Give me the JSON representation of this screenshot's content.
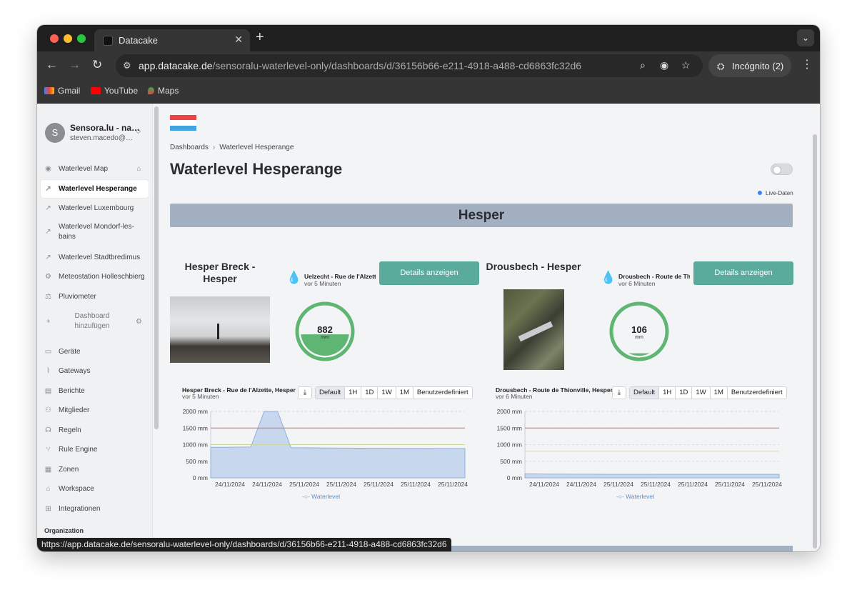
{
  "browser": {
    "tab_title": "Datacake",
    "url_host": "app.datacake.de",
    "url_path": "/sensoralu-waterlevel-only/dashboards/d/36156b66-e211-4918-a488-cd6863fc32d6",
    "incognito_label": "Incógnito (2)",
    "bookmarks": [
      "Gmail",
      "YouTube",
      "Maps"
    ],
    "status_url": "https://app.datacake.de/sensoralu-waterlevel-only/dashboards/d/36156b66-e211-4918-a488-cd6863fc32d6"
  },
  "sidebar": {
    "avatar_letter": "S",
    "org_name": "Sensora.lu - na…",
    "org_email": "steven.macedo@…",
    "dashboards": [
      {
        "label": "Waterlevel Map",
        "icon": "map-pin-icon"
      },
      {
        "label": "Waterlevel Hesperange",
        "icon": "line-chart-icon"
      },
      {
        "label": "Waterlevel Luxembourg",
        "icon": "line-chart-icon"
      },
      {
        "label": "Waterlevel Mondorf-les-bains",
        "icon": "line-chart-icon"
      },
      {
        "label": "Waterlevel Stadtbredimus",
        "icon": "line-chart-icon"
      },
      {
        "label": "Meteostation Holleschbierg",
        "icon": "gear-icon"
      },
      {
        "label": "Pluviometer",
        "icon": "scale-icon"
      },
      {
        "label": "Dashboard hinzufügen",
        "icon": "plus-icon"
      }
    ],
    "nav": [
      {
        "label": "Geräte",
        "icon": "device-icon"
      },
      {
        "label": "Gateways",
        "icon": "antenna-icon"
      },
      {
        "label": "Berichte",
        "icon": "document-icon"
      },
      {
        "label": "Mitglieder",
        "icon": "users-icon"
      },
      {
        "label": "Regeln",
        "icon": "rules-icon"
      },
      {
        "label": "Rule Engine",
        "icon": "branch-icon"
      },
      {
        "label": "Zonen",
        "icon": "map-icon"
      },
      {
        "label": "Workspace",
        "icon": "home-icon"
      },
      {
        "label": "Integrationen",
        "icon": "plus-square-icon"
      }
    ],
    "section_label": "Organization"
  },
  "main": {
    "breadcrumb": [
      "Dashboards",
      "Waterlevel Hesperange"
    ],
    "title": "Waterlevel Hesperange",
    "live_label": "Live-Daten",
    "section_title": "Hesper",
    "flag_colors": [
      "#ef4140",
      "#ffffff",
      "#41a3e0"
    ],
    "devices": [
      {
        "name": "Hesper Breck - Hesper",
        "tile_title": "Uelzecht - Rue de l'Alzette",
        "tile_sub": "vor 5 Minuten",
        "button": "Details anzeigen",
        "gauge_value": "882",
        "gauge_unit": "mm",
        "gauge_fill_fraction": 0.44,
        "chart_title": "Hesper Breck - Rue de l'Alzette, Hesper",
        "chart_sub": "vor 5 Minuten"
      },
      {
        "name": "Drousbech - Hesper",
        "tile_title": "Drousbech - Route de Thionville",
        "tile_sub": "vor 6 Minuten",
        "button": "Details anzeigen",
        "gauge_value": "106",
        "gauge_unit": "mm",
        "gauge_fill_fraction": 0.05,
        "chart_title": "Drousbech - Route de Thionville, Hesper",
        "chart_sub": "vor 6 Minuten"
      }
    ],
    "range_buttons": [
      "Default",
      "1H",
      "1D",
      "1W",
      "1M",
      "Benutzerdefiniert"
    ],
    "selected_range": "Default"
  },
  "chart_data": [
    {
      "type": "area",
      "title": "Hesper Breck - Rue de l'Alzette, Hesper",
      "y_ticks": [
        "2000 mm",
        "1500 mm",
        "1000 mm",
        "500 mm",
        "0 mm"
      ],
      "ylim": [
        0,
        2000
      ],
      "x_ticks": [
        "24/11/2024",
        "24/11/2024",
        "25/11/2024",
        "25/11/2024",
        "25/11/2024",
        "25/11/2024",
        "25/11/2024"
      ],
      "series": [
        {
          "name": "Waterlevel",
          "values": [
            920,
            920,
            925,
            930,
            2000,
            2000,
            910,
            905,
            900,
            898,
            895,
            893,
            890,
            890,
            888,
            886,
            885,
            884,
            883,
            882
          ]
        }
      ],
      "thresholds": [
        {
          "value": 1500,
          "color": "#e06c6c"
        },
        {
          "value": 1000,
          "color": "#c8d89a"
        }
      ],
      "legend": "bottom",
      "grid": true
    },
    {
      "type": "area",
      "title": "Drousbech - Route de Thionville, Hesper",
      "y_ticks": [
        "2000 mm",
        "1500 mm",
        "1000 mm",
        "500 mm",
        "0 mm"
      ],
      "ylim": [
        0,
        2000
      ],
      "x_ticks": [
        "24/11/2024",
        "24/11/2024",
        "25/11/2024",
        "25/11/2024",
        "25/11/2024",
        "25/11/2024",
        "25/11/2024"
      ],
      "series": [
        {
          "name": "Waterlevel",
          "values": [
            120,
            118,
            115,
            112,
            110,
            110,
            108,
            108,
            107,
            107,
            106,
            106,
            106,
            106,
            106,
            106,
            106,
            106,
            106,
            106
          ]
        }
      ],
      "thresholds": [
        {
          "value": 1500,
          "color": "#e06c6c"
        },
        {
          "value": 800,
          "color": "#e8d88a"
        }
      ],
      "legend": "bottom",
      "grid": true
    }
  ]
}
